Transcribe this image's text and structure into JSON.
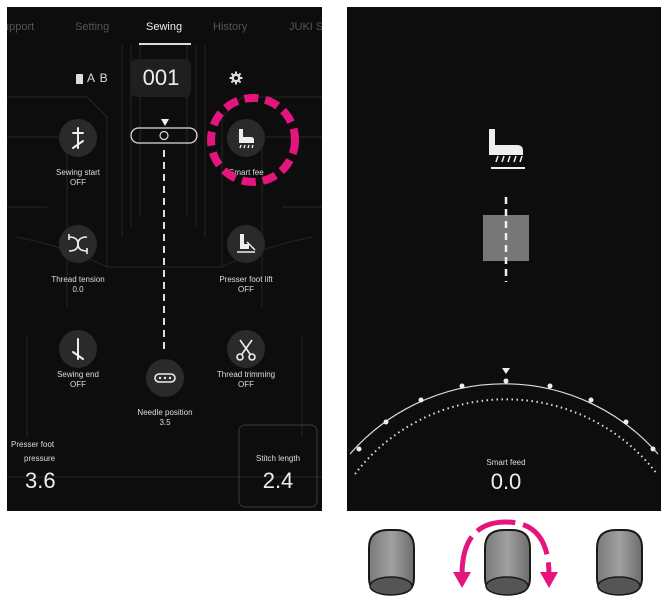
{
  "left_screen": {
    "tabs": [
      {
        "label": "upport"
      },
      {
        "label": "Setting"
      },
      {
        "label": "Sewing"
      },
      {
        "label": "History"
      },
      {
        "label": "JUKI S"
      }
    ],
    "selected_tab": "Sewing",
    "pattern_label": "A B",
    "pattern_number": "001",
    "functions": {
      "sewing_start": {
        "label": "Sewing start",
        "value": "OFF"
      },
      "smart_feed": {
        "label": "Smart fee",
        "value": "0.0"
      },
      "thread_tension": {
        "label": "Thread tension",
        "value": "0.0"
      },
      "presser_foot_lift": {
        "label": "Presser foot lift",
        "value": "OFF"
      },
      "sewing_end": {
        "label": "Sewing end",
        "value": "OFF"
      },
      "thread_trimming": {
        "label": "Thread trimming",
        "value": "OFF"
      },
      "needle_position": {
        "label": "Needle position",
        "value": "3.5"
      }
    },
    "presser_foot_pressure": {
      "label_line1": "Presser foot",
      "label_line2": "pressure",
      "value": "3.6"
    },
    "stitch_length": {
      "label": "Stitch length",
      "value": "2.4"
    }
  },
  "right_screen": {
    "dial_label": "Smart feed",
    "dial_value": "0.0"
  },
  "colors": {
    "highlight": "#e5157e",
    "background": "#0d0d0d",
    "text": "#dddddd",
    "dial_arrow": "#e5157e"
  },
  "icons": [
    "memory-icon",
    "settings-gear-icon",
    "sewing-start-icon",
    "smart-feed-icon",
    "thread-tension-icon",
    "presser-foot-lift-icon",
    "sewing-end-icon",
    "thread-trimming-icon",
    "needle-position-icon",
    "presser-foot-icon",
    "knob-icon",
    "rotate-arrow-icon"
  ]
}
